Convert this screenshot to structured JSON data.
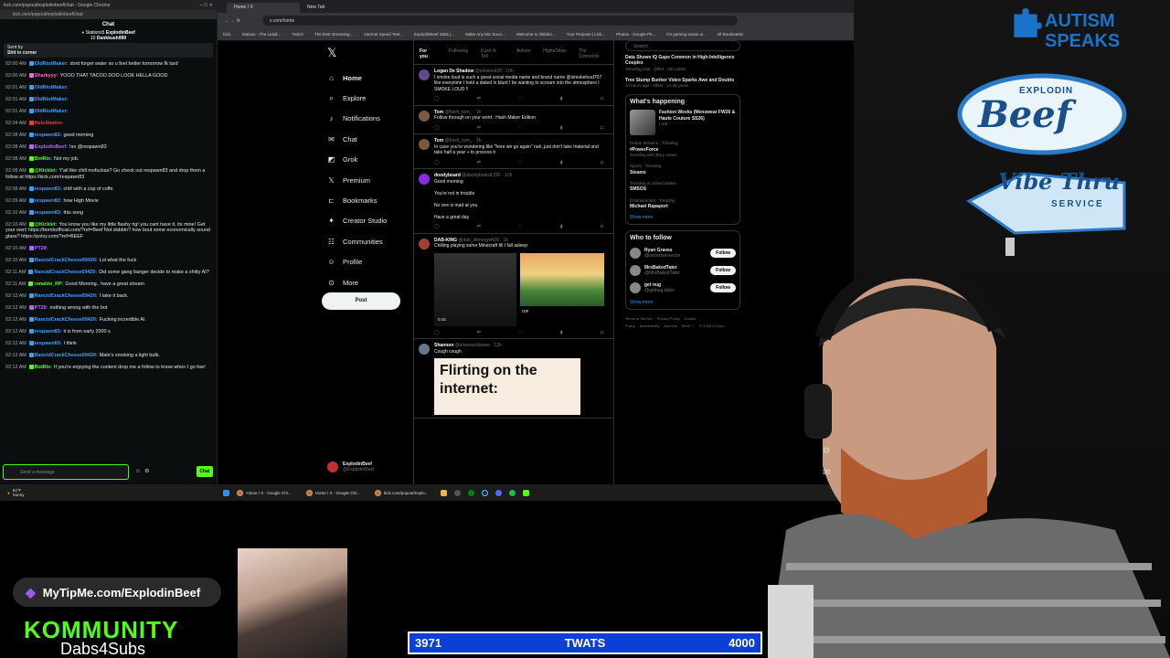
{
  "chat_window": {
    "title": "kick.com/popout/explodinbeef/chat - Google Chrome",
    "url": "kick.com/popout/explodinbeef/chat",
    "header": "Chat",
    "top_supporters": [
      {
        "name": "Stations5",
        "name2": "ExplodinBeef"
      },
      {
        "name": "10",
        "name2": "Dankkush999"
      }
    ],
    "pinned_by": "Sent by",
    "pinned_text": "Shit in corner",
    "messages": [
      {
        "time": "02:00 AM",
        "user": "OldRiotMaker:",
        "text": "dont forget water so u feel better tomorrow fk tard",
        "color": "#3aa0ff"
      },
      {
        "time": "02:00 AM",
        "user": "Sharkyyy:",
        "text": "YOOO THAT TACOO DOO LOOK HELLA GOOD",
        "color": "#ff66cc"
      },
      {
        "time": "02:01 AM",
        "user": "OldRiotMaker:",
        "text": "",
        "color": "#3aa0ff"
      },
      {
        "time": "02:01 AM",
        "user": "OldRiotMaker:",
        "text": "",
        "color": "#3aa0ff"
      },
      {
        "time": "02:01 AM",
        "user": "OldRiotMaker:",
        "text": "",
        "color": "#3aa0ff"
      },
      {
        "time": "02:04 AM",
        "user": "HeloStation:",
        "text": "",
        "color": "#ff3333"
      },
      {
        "time": "02:08 AM",
        "user": "respawn83:",
        "text": "good morning",
        "color": "#3aa0ff"
      },
      {
        "time": "02:08 AM",
        "user": "ExplodinBeef:",
        "text": "!so @respawn83",
        "color": "#b266ff"
      },
      {
        "time": "02:08 AM",
        "user": "BotRix:",
        "text": "Not my job.",
        "color": "#53fc18"
      },
      {
        "time": "02:08 AM",
        "user": "@Kicklet:",
        "text": "Y'all like chill mofuckas? Go check out respawn83 and drop them a follow at https://kick.com/respawn83",
        "color": "#53fc18"
      },
      {
        "time": "02:08 AM",
        "user": "respawn83:",
        "text": "chill with a cup of coffe",
        "color": "#3aa0ff"
      },
      {
        "time": "02:09 AM",
        "user": "respawn83:",
        "text": "how High Movie",
        "color": "#3aa0ff"
      },
      {
        "time": "02:10 AM",
        "user": "respawn83:",
        "text": "this song",
        "color": "#3aa0ff"
      },
      {
        "time": "02:10 AM",
        "user": "@Kicklet:",
        "text": "You know you like my little flashy rig! you cant have it, its mine! Get your own! https://bombofficial.com/?ref=Beef Not dabbin? how bout some economically sound glass? https://polvy.com/?ref=BEEF",
        "color": "#53fc18"
      },
      {
        "time": "02:10 AM",
        "user": "PT28:",
        "text": "",
        "color": "#b266ff"
      },
      {
        "time": "02:10 AM",
        "user": "RancidCrackCheese69420:",
        "text": "Lol what the fuck",
        "color": "#3aa0ff"
      },
      {
        "time": "02:11 AM",
        "user": "RancidCrackCheese69420:",
        "text": "Did some gang banger decide to make a shitty AI?",
        "color": "#3aa0ff"
      },
      {
        "time": "02:11 AM",
        "user": "ronaldo_RP:",
        "text": "Good Morning.. have a great stream",
        "color": "#53fc18"
      },
      {
        "time": "02:12 AM",
        "user": "RancidCrackCheese69420:",
        "text": "I take it back.",
        "color": "#3aa0ff"
      },
      {
        "time": "02:12 AM",
        "user": "PT28:",
        "text": "nothing wrong with the bot",
        "color": "#b266ff"
      },
      {
        "time": "02:12 AM",
        "user": "RancidCrackCheese69420:",
        "text": "Fucking incredible AI.",
        "color": "#3aa0ff"
      },
      {
        "time": "02:12 AM",
        "user": "respawn83:",
        "text": "it is from early 2000 s",
        "color": "#3aa0ff"
      },
      {
        "time": "02:12 AM",
        "user": "respawn83:",
        "text": "I think",
        "color": "#3aa0ff"
      },
      {
        "time": "02:12 AM",
        "user": "RancidCrackCheese69420:",
        "text": "Mate's smoking a light bulb.",
        "color": "#3aa0ff"
      },
      {
        "time": "02:12 AM",
        "user": "BotRix:",
        "text": "If you're enjoying the content drop me a follow to know when I go live!",
        "color": "#53fc18"
      }
    ],
    "input_placeholder": "Send a message",
    "chat_button": "Chat"
  },
  "browser": {
    "tabs": [
      "Home / X",
      "New Tab"
    ],
    "url": "x.com/home",
    "bookmarks": [
      "Kick",
      "Statsus - The Leadi...",
      "Twitch",
      "The best streaming...",
      "Internet Speed Test...",
      "ExplodinBeef Stats |...",
      "Make Any Mic Soun...",
      "Welcome to Oklaho...",
      "Your Purpose | Lick...",
      "Photos - Google Ph...",
      "I'm gaming susan w...",
      "All Bookmarks"
    ]
  },
  "x_nav": {
    "items": [
      "Home",
      "Explore",
      "Notifications",
      "Chat",
      "Grok",
      "Premium",
      "Bookmarks",
      "Creator Studio",
      "Communities",
      "Profile",
      "More"
    ],
    "icons": [
      "home-icon",
      "search-icon",
      "bell-icon",
      "chat-icon",
      "grok-icon",
      "x-icon",
      "bookmark-icon",
      "creator-icon",
      "communities-icon",
      "profile-icon",
      "more-icon"
    ],
    "post_button": "Post",
    "account_name": "ExplodinBeef",
    "account_handle": "@ExplodinBeef"
  },
  "feed": {
    "tabs": [
      "For you",
      "Following",
      "Kush N Tell",
      "Autism",
      "HighaShop",
      "The Connectio"
    ],
    "tweets": [
      {
        "name": "Logan De Shadow",
        "handle": "@smokin420 · 10h",
        "text": "I smoke loud is such a great social media name and brand name @ismokeloud707 like everytime I hold a dialed in blunt I be wanting to scream into the atmosphere I SMOKE LOUD !!",
        "color": "#5d4a8a"
      },
      {
        "name": "Tom",
        "handle": "@hash_tom_ · 1h",
        "text": "Follow through on your word : Hash Maker Edition",
        "color": "#7a5a40"
      },
      {
        "name": "Tom",
        "handle": "@hash_tom_ · 1h",
        "text": "In case you're wondering like \"here we go again\" nah, just don't take material and take half a year + to process it",
        "color": "#7a5a40"
      },
      {
        "name": "doodyboard",
        "handle": "@doodyboardLIVE · 12h",
        "text": "Good morning\n\nYou're not in trouble\n\nNo one is mad at you\n\nHave a great day",
        "color": "#8a2be2"
      },
      {
        "name": "DAB-KING",
        "handle": "@dab_stoneyyd420 · 1h",
        "text": "Chilling playing some Minecraft till I fall asleep",
        "color": "#a04030"
      },
      {
        "name": "Shannon",
        "handle": "@shannondonee · 13h",
        "text": "Cough cough",
        "color": "#667788"
      }
    ],
    "video_time": "0:15",
    "gif_label": "GIF",
    "meme_text": "Flirting on the internet:"
  },
  "right_col": {
    "search_placeholder": "Search",
    "trends_top": [
      {
        "title": "Data Shows IQ Gaps Common in High-Intelligence Couples",
        "sub": "Trending now · Other · 281 posts"
      },
      {
        "title": "Tree Stump Bunker Video Sparks Awe and Doubts",
        "sub": "14 hours ago · Other · 11.4K posts"
      }
    ],
    "happening_title": "What's happening",
    "happening_event": "Fashion Weeks (Menswear FW26 & Haute Couture SS26)",
    "happening_sub": "LIVE",
    "trends": [
      {
        "sub": "Online Streams · Trending",
        "title": "#PowerForce",
        "sub2": "Trending with Terry Jones"
      },
      {
        "sub": "Sports · Trending",
        "title": "Steams",
        "sub2": ""
      },
      {
        "sub": "Trending in United States",
        "title": "SMSOS",
        "sub2": ""
      },
      {
        "sub": "Entertainment · Trending",
        "title": "Michael Rapaport",
        "sub2": ""
      }
    ],
    "show_more": "Show more",
    "who_to_follow": "Who to follow",
    "follow_suggestions": [
      {
        "name": "Ryan Graves",
        "handle": "@uncertainvector"
      },
      {
        "name": "MrsBakedTater",
        "handle": "@MrsBakedTater"
      },
      {
        "name": "get nug",
        "handle": "@getnug.dabs"
      }
    ],
    "follow_button": "Follow",
    "footer": [
      "Terms of Service",
      "Privacy Policy",
      "Cookie Policy",
      "Accessibility",
      "Ads info",
      "More ···",
      "© 2026 X Corp."
    ]
  },
  "taskbar": {
    "weather": "54°F",
    "weather_sub": "Sunny",
    "items": [
      "Home / X - Google Chr...",
      "Home / X - Google Chr...",
      "kick.com/popout/explo..."
    ]
  },
  "overlay": {
    "mytip": "MyTipMe.com/ExplodinBeef",
    "kommunity": "KOMMUNITY",
    "dabs4subs": "Dabs4Subs",
    "goal_current": "3971",
    "goal_label": "TWATS",
    "goal_target": "4000",
    "goal_progress": 0.99275,
    "autism_speaks": "AUTISM SPEAKS",
    "beef_explodin": "EXPLODIN",
    "beef_word": "Beef",
    "beef_vibe": "Vibe Thru",
    "beef_service": "SERVICE"
  }
}
